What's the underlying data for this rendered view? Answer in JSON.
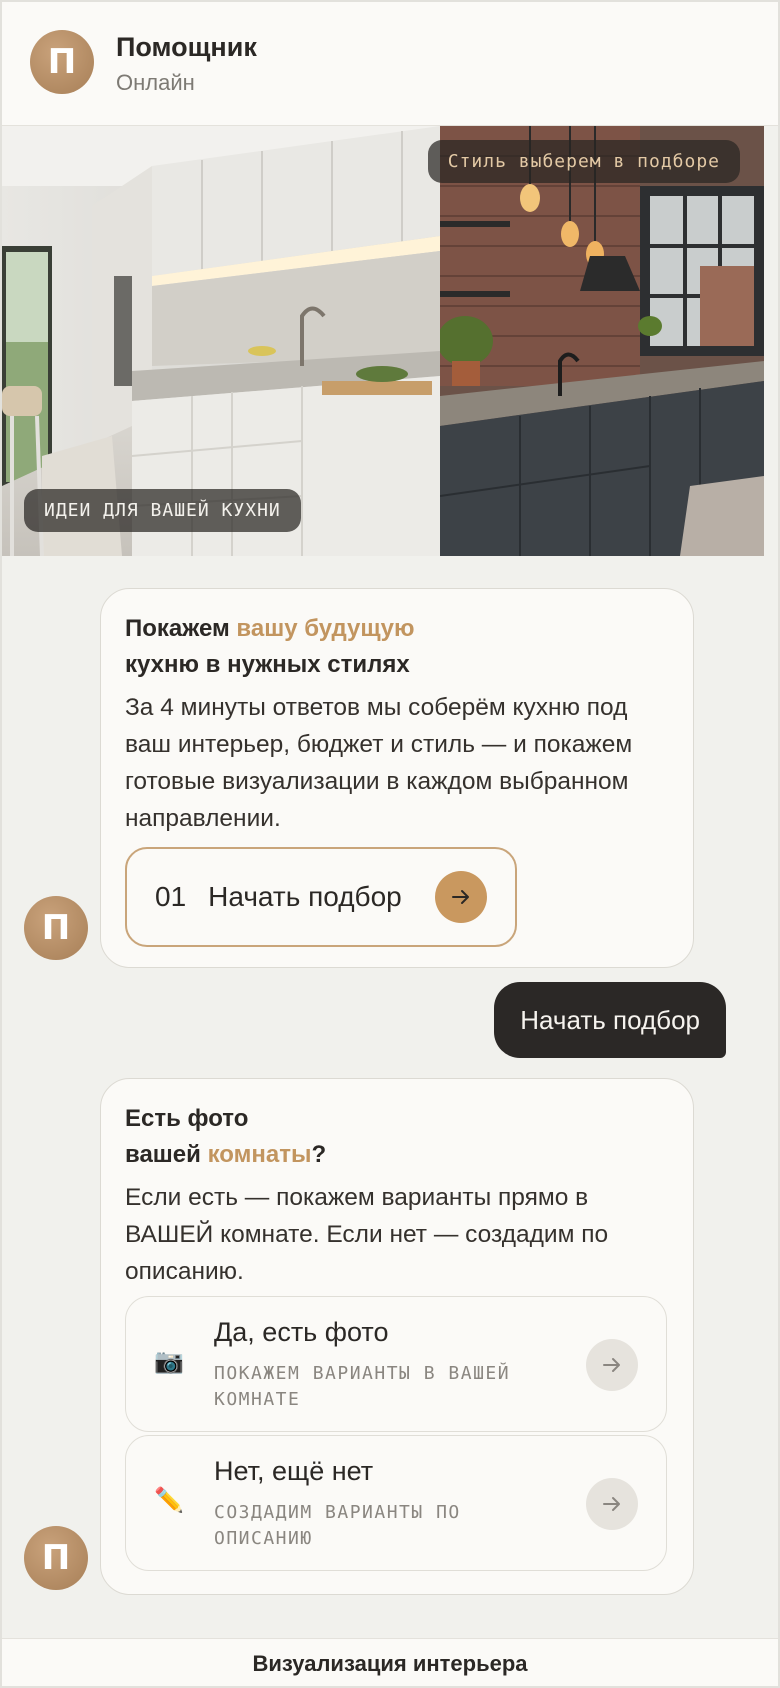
{
  "header": {
    "avatar_letter": "П",
    "title": "Помощник",
    "status": "Онлайн"
  },
  "hero": {
    "tag_top": "Стиль выберем в подборе",
    "tag_bottom": "ИДЕИ ДЛЯ ВАШЕЙ КУХНИ"
  },
  "messages": {
    "intro": {
      "title_part1": "Покажем ",
      "title_accent": "вашу будущую",
      "title_part2": "кухню в нужных стилях",
      "text": "За 4 минуты ответов мы соберём кухню под ваш интерьер, бюджет и стиль — и покажем готовые визуализации в каждом выбранном направлении.",
      "button_number": "01",
      "button_label": "Начать подбор",
      "avatar_letter": "П"
    },
    "user_reply": "Начать подбор",
    "photo_question": {
      "title_line1": "Есть фото",
      "title_part1": "вашей ",
      "title_accent": "комнаты",
      "title_end": "?",
      "text": "Если есть — покажем варианты прямо в ВАШЕЙ комнате. Если нет — создадим по описанию.",
      "avatar_letter": "П",
      "options": [
        {
          "icon": "camera-icon",
          "glyph": "📷",
          "title": "Да, есть фото",
          "subtitle": "ПОКАЖЕМ ВАРИАНТЫ В ВАШЕЙ КОМНАТЕ"
        },
        {
          "icon": "pencil-icon",
          "glyph": "✏️",
          "title": "Нет, ещё нет",
          "subtitle": "СОЗДАДИМ ВАРИАНТЫ ПО ОПИСАНИЮ"
        }
      ]
    }
  },
  "footer": {
    "label": "Визуализация интерьера"
  },
  "colors": {
    "accent": "#c2955f",
    "avatar": "#b68c62",
    "user_bubble": "#2b2826",
    "background": "#f1f1ed"
  }
}
